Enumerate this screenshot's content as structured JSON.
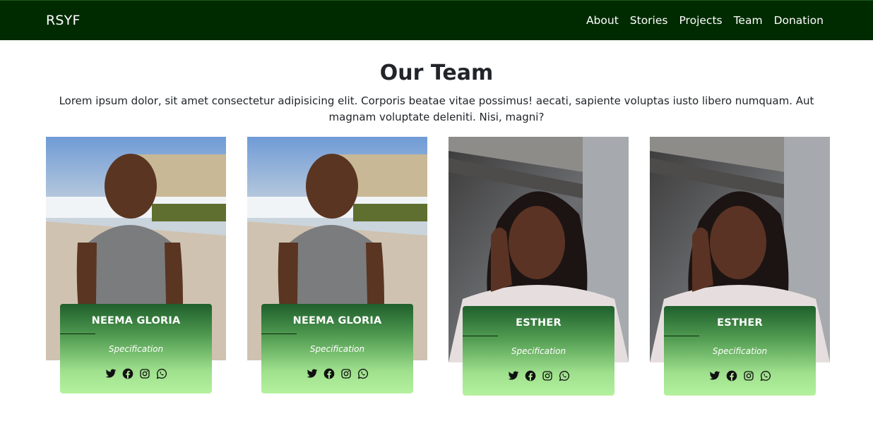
{
  "navbar": {
    "brand": "RSYF",
    "links": [
      "About",
      "Stories",
      "Projects",
      "Team",
      "Donation"
    ]
  },
  "section": {
    "title": "Our Team",
    "description": "Lorem ipsum dolor, sit amet consectetur adipisicing elit. Corporis beatae vitae possimus! aecati, sapiente voluptas iusto libero numquam. Aut magnam voluptate deleniti. Nisi, magni?"
  },
  "team": [
    {
      "name": "NEEMA GLORIA",
      "role": "Specification",
      "socials": [
        "twitter-icon",
        "facebook-icon",
        "instagram-icon",
        "whatsapp-icon"
      ]
    },
    {
      "name": "NEEMA GLORIA",
      "role": "Specification",
      "socials": [
        "twitter-icon",
        "facebook-icon",
        "instagram-icon",
        "whatsapp-icon"
      ]
    },
    {
      "name": "ESTHER",
      "role": "Specification",
      "socials": [
        "twitter-icon",
        "facebook-icon",
        "instagram-icon",
        "whatsapp-icon"
      ]
    },
    {
      "name": "ESTHER",
      "role": "Specification",
      "socials": [
        "twitter-icon",
        "facebook-icon",
        "instagram-icon",
        "whatsapp-icon"
      ]
    }
  ],
  "colors": {
    "navbar_bg": "#002b00",
    "card_gradient_top": "#1f5f2c",
    "card_gradient_bottom": "#b4f19e"
  }
}
